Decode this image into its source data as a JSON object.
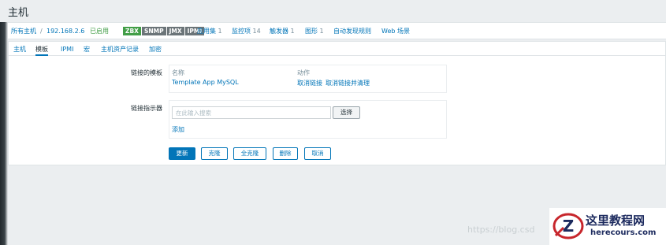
{
  "page": {
    "title": "主机"
  },
  "breadcrumb": {
    "all_hosts": "所有主机",
    "separator": "/",
    "host": "192.168.2.6",
    "status": "已启用",
    "tags": [
      "ZBX",
      "SNMP",
      "JMX",
      "IPMI"
    ],
    "links": [
      {
        "label": "应用集",
        "count": "1"
      },
      {
        "label": "监控项",
        "count": "14"
      },
      {
        "label": "触发器",
        "count": "1"
      },
      {
        "label": "图形",
        "count": "1"
      }
    ],
    "discovery": "自动发现规则",
    "web": "Web 场景"
  },
  "tabs": [
    "主机",
    "模板",
    "IPMI",
    "宏",
    "主机资产记录",
    "加密"
  ],
  "active_tab": "模板",
  "linked_templates": {
    "label": "链接的模板",
    "col_name": "名称",
    "col_action": "动作",
    "template": "Template App MySQL",
    "unlink": "取消链接",
    "unlink_clear": "取消链接并清理"
  },
  "link_indicator": {
    "label": "链接指示器",
    "placeholder": "在此输入搜索",
    "select": "选择",
    "add": "添加"
  },
  "actions": {
    "update": "更新",
    "clone": "克隆",
    "full_clone": "全克隆",
    "delete": "删除",
    "cancel": "取消"
  },
  "watermark": "https://blog.csd",
  "logo": {
    "title": "这里教程网",
    "url": "herecours.com",
    "mark": "Z"
  },
  "colors": {
    "link": "#0275b8",
    "status_enabled": "#429e47",
    "tag_inactive": "#6b7478",
    "primary": "#0275b8"
  }
}
